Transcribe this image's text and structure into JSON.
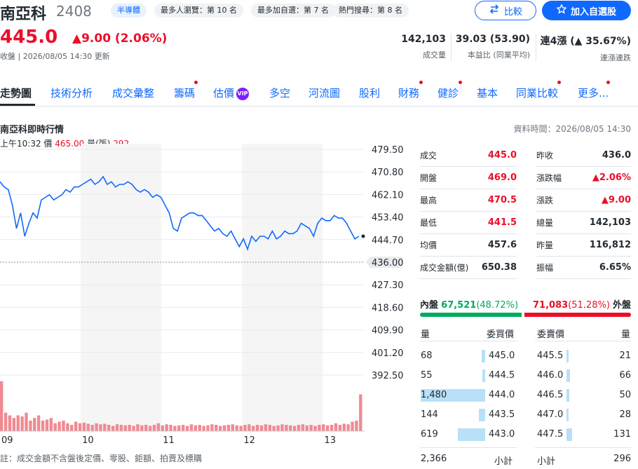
{
  "header": {
    "name": "南亞科",
    "code": "2408",
    "badge_industry": "半導體",
    "badge_views": "最多人瀏覽：第 10 名",
    "badge_watch": "最多加自選：第 7 名",
    "badge_search": "熱門搜尋：第 8 名",
    "compare_label": "比較",
    "add_watchlist_label": "加入自選股"
  },
  "price": {
    "value": "445.0",
    "change": "▲9.00 (2.06%)",
    "time": "收盤 | 2026/08/05 14:30 更新"
  },
  "stats": [
    {
      "value": "142,103",
      "label": "成交量"
    },
    {
      "value": "39.03 (53.90)",
      "label": "本益比 (同業平均)"
    },
    {
      "value": "連4漲 (▲ 35.67%)",
      "label": "連漲連跌"
    }
  ],
  "tabs": [
    "走勢圖",
    "技術分析",
    "成交彙整",
    "籌碼",
    "估價",
    "多空",
    "河流圖",
    "股利",
    "財務",
    "健診",
    "基本",
    "同業比較",
    "更多..."
  ],
  "vip_label": "VIP",
  "section": {
    "title": "南亞科即時行情",
    "data_time": "資料時間：2026/08/05 14:30",
    "cursor_time": "上午10:32",
    "cursor_price_label": "價",
    "cursor_price": "465.00",
    "cursor_vol_label": "量(張)",
    "cursor_vol": "292"
  },
  "chart_data": {
    "type": "line",
    "y_ticks": [
      "479.50",
      "470.80",
      "462.10",
      "453.40",
      "444.70",
      "436.00",
      "427.30",
      "418.60",
      "409.90",
      "401.20",
      "392.50"
    ],
    "x_ticks": [
      "09",
      "10",
      "11",
      "12",
      "13"
    ],
    "reference_price": "436.00",
    "ylim": [
      392.5,
      479.5
    ],
    "series": [
      {
        "values": [
          467,
          465,
          464,
          458,
          449,
          455,
          446,
          451,
          455,
          453,
          460,
          461,
          462,
          460,
          461,
          462,
          464,
          463,
          465,
          465,
          466,
          467,
          468,
          466,
          467,
          469,
          466,
          467,
          465,
          466,
          466,
          467,
          466,
          464,
          463,
          464,
          463,
          461,
          462,
          461,
          458,
          455,
          449,
          448,
          453,
          454,
          455,
          455,
          454,
          454,
          452,
          450,
          448,
          449,
          447,
          446,
          448,
          445,
          442,
          445,
          441,
          446,
          444,
          446,
          446,
          445,
          448,
          445,
          446,
          448,
          447,
          447,
          448,
          451,
          450,
          449,
          446,
          451,
          453,
          452,
          452,
          454,
          453,
          453,
          451,
          448,
          445,
          446
        ]
      }
    ],
    "volume": [
      0.95,
      0.35,
      0.3,
      0.25,
      0.3,
      0.28,
      0.35,
      0.2,
      0.25,
      0.3,
      0.2,
      0.22,
      0.25,
      0.15,
      0.18,
      0.2,
      0.15,
      0.12,
      0.18,
      0.15,
      0.16,
      0.14,
      0.12,
      0.15,
      0.13,
      0.14,
      0.12,
      0.1,
      0.13,
      0.12,
      0.11,
      0.12,
      0.1,
      0.13,
      0.11,
      0.12,
      0.1,
      0.12,
      0.15,
      0.11,
      0.13,
      0.12,
      0.1,
      0.11,
      0.12,
      0.1,
      0.13,
      0.11,
      0.12,
      0.1,
      0.11,
      0.13,
      0.12,
      0.1,
      0.11,
      0.12,
      0.13,
      0.11,
      0.1,
      0.12,
      0.13,
      0.1,
      0.12,
      0.11,
      0.13,
      0.12,
      0.1,
      0.11,
      0.13,
      0.12,
      0.11,
      0.1,
      0.12,
      0.13,
      0.11,
      0.12,
      0.1,
      0.12,
      0.13,
      0.11,
      0.12,
      0.15,
      0.12,
      0.14,
      0.13,
      0.18,
      0.2,
      0.7
    ]
  },
  "quote": [
    {
      "l": "成交",
      "v": "445.0",
      "c": "red",
      "l2": "昨收",
      "v2": "436.0",
      "c2": "dark"
    },
    {
      "l": "開盤",
      "v": "469.0",
      "c": "red",
      "l2": "漲跌幅",
      "v2": "▲2.06%",
      "c2": "red"
    },
    {
      "l": "最高",
      "v": "470.5",
      "c": "red",
      "l2": "漲跌",
      "v2": "▲9.00",
      "c2": "red"
    },
    {
      "l": "最低",
      "v": "441.5",
      "c": "red",
      "l2": "總量",
      "v2": "142,103",
      "c2": "dark"
    },
    {
      "l": "均價",
      "v": "457.6",
      "c": "dark",
      "l2": "昨量",
      "v2": "116,812",
      "c2": "dark"
    },
    {
      "l": "成交金額(億)",
      "v": "650.38",
      "c": "dark",
      "l2": "振幅",
      "v2": "6.65%",
      "c2": "dark"
    }
  ],
  "orderbook": {
    "inner_label": "內盤",
    "inner_value": "67,521",
    "inner_pct": "(48.72%)",
    "outer_value": "71,083",
    "outer_pct": "(51.28%)",
    "outer_label": "外盤",
    "inner_share": 0.4872,
    "head_vol": "量",
    "head_bid": "委買價",
    "head_ask": "委賣價",
    "head_vol2": "量",
    "rows": [
      {
        "bv": "68",
        "bp": "445.0",
        "ap": "445.5",
        "av": "21",
        "bw": 0.05,
        "aw": 0.03
      },
      {
        "bv": "55",
        "bp": "444.5",
        "ap": "446.0",
        "av": "66",
        "bw": 0.04,
        "aw": 0.05
      },
      {
        "bv": "1,480",
        "bp": "444.0",
        "ap": "446.5",
        "av": "50",
        "bw": 1.0,
        "aw": 0.04
      },
      {
        "bv": "144",
        "bp": "443.5",
        "ap": "447.0",
        "av": "28",
        "bw": 0.1,
        "aw": 0.03
      },
      {
        "bv": "619",
        "bp": "443.0",
        "ap": "447.5",
        "av": "131",
        "bw": 0.42,
        "aw": 0.09
      }
    ],
    "total_bid": "2,366",
    "subtotal_label": "小計",
    "total_ask": "296"
  },
  "note": "註：成交金額不含盤後定價、零股、鉅額、拍賣及標購"
}
